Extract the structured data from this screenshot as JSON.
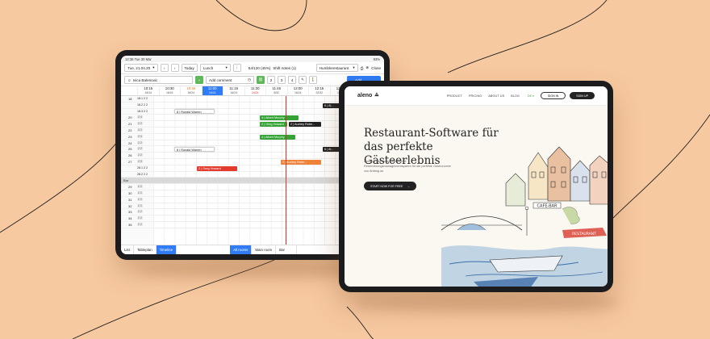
{
  "colors": {
    "background": "#f7c9a0",
    "accent_blue": "#2f7cf6",
    "green": "#33a336",
    "red": "#e23b2e",
    "orange": "#f0833a",
    "dark": "#222222"
  },
  "timeline_app": {
    "status_left": "12:36  Tue 30 Mar",
    "status_right": "93%",
    "toolbar": {
      "date": "Tue, 21.04.20",
      "prev_icon": "chevron-left-icon",
      "next_icon": "chevron-right-icon",
      "today": "Today",
      "shift": "Lunch",
      "more": "⋮",
      "occupancy": "54/120 (45%)",
      "shift_notes": "Shift notes (1)",
      "restaurant": "Humblerestaurant",
      "print_icon": "printer-icon",
      "close_icon": "close-circle-icon",
      "close": "Close"
    },
    "toolbar2": {
      "guest": "Ivica Balenovic",
      "add_comment": "Add comment",
      "party_sizes": [
        "2",
        "3",
        "4"
      ],
      "walkin_icon": "walk-in-icon",
      "primary": "Add"
    },
    "times": [
      {
        "t": "10:15",
        "d": "16/24",
        "state": ""
      },
      {
        "t": "10:30",
        "d": "16/24",
        "state": ""
      },
      {
        "t": "10:45",
        "d": "16/24",
        "state": "orange"
      },
      {
        "t": "11:00",
        "d": "16/24",
        "state": "active"
      },
      {
        "t": "11:15",
        "d": "16/24",
        "state": ""
      },
      {
        "t": "11:30",
        "d": "24/24",
        "state": "red"
      },
      {
        "t": "11:45",
        "d": "8/32",
        "state": ""
      },
      {
        "t": "12:00",
        "d": "16/24",
        "state": ""
      },
      {
        "t": "12:15",
        "d": "22/32",
        "state": ""
      },
      {
        "t": "12:30",
        "d": "16/24",
        "state": ""
      }
    ],
    "rows": [
      {
        "table": "18",
        "cap": "2 2",
        "sub": "18.1 2 2"
      },
      {
        "table": "",
        "cap": "",
        "sub": "18.2 2 2"
      },
      {
        "table": "",
        "cap": "",
        "sub": "18.3 2 2"
      },
      {
        "table": "20",
        "cap": "2 4",
        "sub": ""
      },
      {
        "table": "21",
        "cap": "2 2",
        "sub": ""
      },
      {
        "table": "22",
        "cap": "2 2",
        "sub": ""
      },
      {
        "table": "23",
        "cap": "2 4",
        "sub": ""
      },
      {
        "table": "24",
        "cap": "2 2",
        "sub": ""
      },
      {
        "table": "25",
        "cap": "2 2",
        "sub": ""
      },
      {
        "table": "26",
        "cap": "2 2",
        "sub": ""
      },
      {
        "table": "27",
        "cap": "2 5",
        "sub": ""
      },
      {
        "table": "",
        "cap": "",
        "sub": "28.1 2 2"
      },
      {
        "table": "",
        "cap": "",
        "sub": "28.2 2 2"
      }
    ],
    "section_label": "Bar",
    "bar_rows": [
      "29",
      "30",
      "31",
      "32",
      "33",
      "34",
      "35"
    ],
    "reservations": [
      {
        "label": "8 | Ronald Warren",
        "style": "white",
        "row": 2
      },
      {
        "label": "4 | Albert Murphy",
        "style": "green",
        "row": 3
      },
      {
        "label": "2 | Greg Howard",
        "style": "green",
        "row": 4
      },
      {
        "label": "2 | Audrey Robe...",
        "style": "dark",
        "row": 4
      },
      {
        "label": "4 | Albert Murphy",
        "style": "green",
        "row": 6
      },
      {
        "label": "8 | Ronald Warren",
        "style": "white",
        "row": 8
      },
      {
        "label": "2 | Audrey Robe...",
        "style": "orange",
        "row": 10
      },
      {
        "label": "2 | Greg Howard",
        "style": "red",
        "row": 11
      },
      {
        "label": "6 | Al...",
        "style": "dark",
        "row": 1
      },
      {
        "label": "6 | Al...",
        "style": "dark",
        "row": 8
      }
    ],
    "bottom_tabs": [
      "List",
      "Tableplan",
      "Timeline"
    ],
    "room_tabs": [
      "All rooms",
      "Main room",
      "Bar"
    ]
  },
  "website": {
    "logo": "aleno",
    "nav": [
      "PRODUCT",
      "PRICING",
      "ABOUT US",
      "BLOG"
    ],
    "language": "DE ▾",
    "sign_in": "SIGN IN",
    "sign_up": "SIGN UP",
    "title_line1": "Restaurant-Software für",
    "title_line2": "das perfekte Gästeerlebnis",
    "subtitle": "aleno ist das zukunftsweisende Reservierungsmanagementsystem für die perfekte Gastronomie von Anfang an.",
    "cta": "START NOW FOR FREE",
    "sketch_sign": "CAFE-BAR",
    "sketch_sign2": "RESTAURANT"
  }
}
